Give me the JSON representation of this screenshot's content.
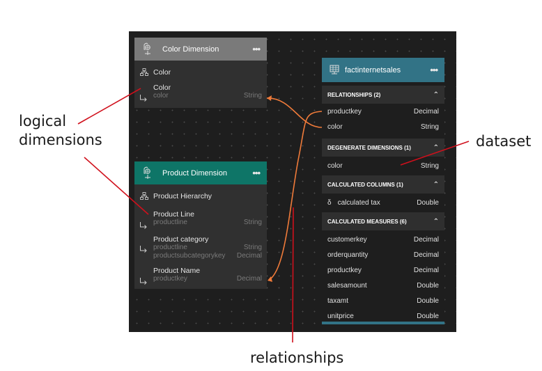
{
  "colors": {
    "canvas": "#1e1e1e",
    "color_dimension_header": "#7a7a7a",
    "product_dimension_header": "#0e7567",
    "dataset_header": "#327386",
    "relationship_line": "#f07b3a",
    "annotation_line": "#d0101c"
  },
  "color_dimension": {
    "title": "Color Dimension",
    "more_label": "•••",
    "hierarchy": {
      "label": "Color",
      "icon": "hierarchy-icon"
    },
    "attributes": [
      {
        "name": "Color",
        "columns": [
          {
            "column": "color",
            "type": "String"
          }
        ]
      }
    ]
  },
  "product_dimension": {
    "title": "Product Dimension",
    "more_label": "•••",
    "hierarchy": {
      "label": "Product Hierarchy",
      "icon": "hierarchy-icon"
    },
    "attributes": [
      {
        "name": "Product Line",
        "columns": [
          {
            "column": "productline",
            "type": "String"
          }
        ]
      },
      {
        "name": "Product category",
        "columns": [
          {
            "column": "productline",
            "type": "String"
          },
          {
            "column": "productsubcategorykey",
            "type": "Decimal"
          }
        ]
      },
      {
        "name": "Product Name",
        "columns": [
          {
            "column": "productkey",
            "type": "Decimal"
          }
        ]
      }
    ]
  },
  "dataset": {
    "title": "factinternetsales",
    "more_label": "•••",
    "sections": [
      {
        "title": "RELATIONSHIPS (2)",
        "rows": [
          {
            "name": "productkey",
            "type": "Decimal"
          },
          {
            "name": "color",
            "type": "String"
          }
        ]
      },
      {
        "title": "DEGENERATE DIMENSIONS (1)",
        "rows": [
          {
            "name": "color",
            "type": "String"
          }
        ]
      },
      {
        "title": "CALCULATED COLUMNS (1)",
        "rows": [
          {
            "name": "calculated tax",
            "type": "Double",
            "prefix": "δ"
          }
        ]
      },
      {
        "title": "CALCULATED MEASURES (6)",
        "rows": [
          {
            "name": "customerkey",
            "type": "Decimal"
          },
          {
            "name": "orderquantity",
            "type": "Decimal"
          },
          {
            "name": "productkey",
            "type": "Decimal"
          },
          {
            "name": "salesamount",
            "type": "Double"
          },
          {
            "name": "taxamt",
            "type": "Double"
          },
          {
            "name": "unitprice",
            "type": "Double"
          }
        ]
      }
    ]
  },
  "annotations": {
    "logical_dimensions_line1": "logical",
    "logical_dimensions_line2": "dimensions",
    "dataset": "dataset",
    "relationships": "relationships"
  }
}
